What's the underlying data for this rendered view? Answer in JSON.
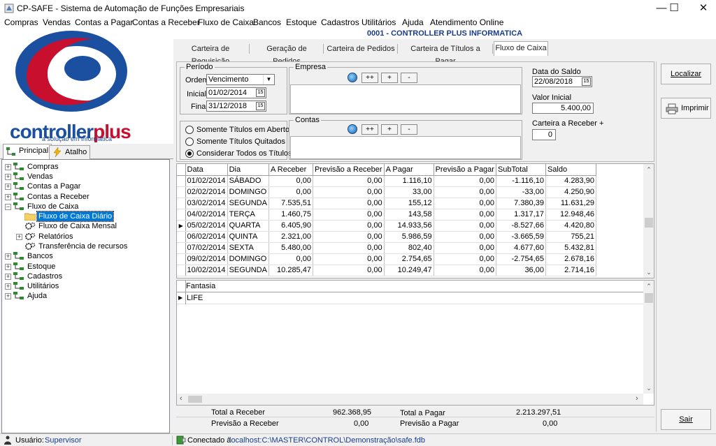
{
  "window": {
    "title": "CP-SAFE  -  Sistema de Automação de Funções Empresariais"
  },
  "menu": [
    "Compras",
    "Vendas",
    "Contas a Pagar",
    "Contas a Receber",
    "Fluxo de Caixa",
    "Bancos",
    "Estoque",
    "Cadastros",
    "Utilitários",
    "Ajuda",
    "Atendimento Online"
  ],
  "company": "0001 - CONTROLLER PLUS INFORMATICA",
  "logo": {
    "brand_left": "controller",
    "brand_right": "plus",
    "tagline": "a solução em informática"
  },
  "left_tabs": [
    "Principal",
    "Atalho"
  ],
  "tree": [
    {
      "label": "Compras"
    },
    {
      "label": "Vendas"
    },
    {
      "label": "Contas a Pagar"
    },
    {
      "label": "Contas a Receber"
    },
    {
      "label": "Fluxo de Caixa"
    },
    {
      "label": "Fluxo de Caixa Diário"
    },
    {
      "label": "Fluxo de Caixa Mensal"
    },
    {
      "label": "Relatórios"
    },
    {
      "label": "Transferência de recursos"
    },
    {
      "label": "Bancos"
    },
    {
      "label": "Estoque"
    },
    {
      "label": "Cadastros"
    },
    {
      "label": "Utilitários"
    },
    {
      "label": "Ajuda"
    }
  ],
  "tabs": [
    "Carteira de Requisição",
    "Geração de Pedidos",
    "Carteira de Pedidos",
    "Carteira de Títulos a Pagar",
    "Fluxo de Caixa"
  ],
  "filter": {
    "periodo_label": "Período",
    "ordem_label": "Ordem",
    "ordem_value": "Vencimento",
    "inicial_label": "Inicial",
    "inicial_value": "01/02/2014",
    "final_label": "Final",
    "final_value": "31/12/2018",
    "empresa_label": "Empresa",
    "contas_label": "Contas",
    "btn_all": "++",
    "btn_add": "+",
    "btn_remove": "-",
    "radio_aberto": "Somente Títulos em Aberto",
    "radio_quitados": "Somente Títulos Quitados",
    "radio_todos": "Considerar Todos os Títulos",
    "data_saldo_label": "Data do Saldo",
    "data_saldo_value": "22/08/2018",
    "valor_inicial_label": "Valor Inicial",
    "valor_inicial_value": "5.400,00",
    "carteira_label": "Carteira a Receber +",
    "carteira_value": "0"
  },
  "buttons": {
    "localizar": "Localizar",
    "imprimir": "Imprimir",
    "sair": "Sair"
  },
  "grid": {
    "columns": [
      "Data",
      "Dia",
      "A Receber",
      "Previsão a Receber",
      "A Pagar",
      "Previsão a Pagar",
      "SubTotal",
      "Saldo"
    ],
    "rows": [
      [
        "01/02/2014",
        "SÁBADO",
        "0,00",
        "0,00",
        "1.116,10",
        "0,00",
        "-1.116,10",
        "4.283,90"
      ],
      [
        "02/02/2014",
        "DOMINGO",
        "0,00",
        "0,00",
        "33,00",
        "0,00",
        "-33,00",
        "4.250,90"
      ],
      [
        "03/02/2014",
        "SEGUNDA",
        "7.535,51",
        "0,00",
        "155,12",
        "0,00",
        "7.380,39",
        "11.631,29"
      ],
      [
        "04/02/2014",
        "TERÇA",
        "1.460,75",
        "0,00",
        "143,58",
        "0,00",
        "1.317,17",
        "12.948,46"
      ],
      [
        "05/02/2014",
        "QUARTA",
        "6.405,90",
        "0,00",
        "14.933,56",
        "0,00",
        "-8.527,66",
        "4.420,80"
      ],
      [
        "06/02/2014",
        "QUINTA",
        "2.321,00",
        "0,00",
        "5.986,59",
        "0,00",
        "-3.665,59",
        "755,21"
      ],
      [
        "07/02/2014",
        "SEXTA",
        "5.480,00",
        "0,00",
        "802,40",
        "0,00",
        "4.677,60",
        "5.432,81"
      ],
      [
        "09/02/2014",
        "DOMINGO",
        "0,00",
        "0,00",
        "2.754,65",
        "0,00",
        "-2.754,65",
        "2.678,16"
      ],
      [
        "10/02/2014",
        "SEGUNDA",
        "10.285,47",
        "0,00",
        "10.249,47",
        "0,00",
        "36,00",
        "2.714,16"
      ]
    ],
    "selected_row": 4
  },
  "subgrid": {
    "column": "Fantasia",
    "rows": [
      "LIFE"
    ]
  },
  "totals": {
    "total_receber_label": "Total a Receber",
    "total_receber_value": "962.368,95",
    "total_pagar_label": "Total a Pagar",
    "total_pagar_value": "2.213.297,51",
    "prev_receber_label": "Previsão a Receber",
    "prev_receber_value": "0,00",
    "prev_pagar_label": "Previsão a Pagar",
    "prev_pagar_value": "0,00"
  },
  "status": {
    "user_label": "Usuário:",
    "user_value": "Supervisor",
    "conn_label": "Conectado à",
    "conn_value": "localhost:C:\\MASTER\\CONTROL\\Demonstração\\safe.fdb"
  },
  "colors": {
    "accent": "#1a3b8c",
    "selection": "#0078d7",
    "logo_red": "#c8102e",
    "logo_blue": "#1b4fa0"
  }
}
